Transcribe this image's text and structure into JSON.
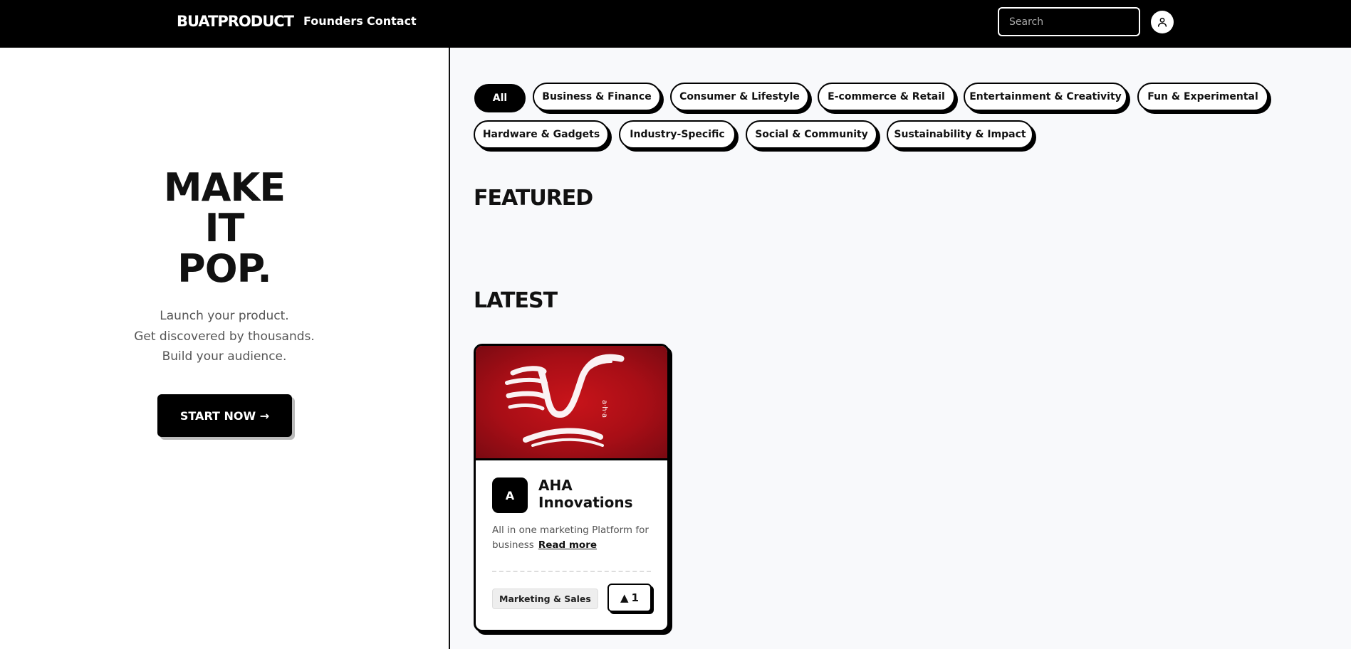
{
  "header": {
    "brand": "BUATPRODUCT",
    "nav": [
      "Founders",
      "Contact"
    ],
    "search_placeholder": "Search",
    "user_icon": "user-icon"
  },
  "hero": {
    "title_lines": [
      "MAKE",
      "IT",
      "POP."
    ],
    "subtitle_lines": [
      "Launch your product.",
      "Get discovered by thousands.",
      "Build your audience."
    ],
    "cta": "START NOW →"
  },
  "categories": [
    {
      "label": "All",
      "active": true
    },
    {
      "label": "Business & Finance",
      "active": false
    },
    {
      "label": "Consumer & Lifestyle",
      "active": false
    },
    {
      "label": "E-commerce & Retail",
      "active": false
    },
    {
      "label": "Entertainment & Creativity",
      "active": false
    },
    {
      "label": "Fun & Experimental",
      "active": false
    },
    {
      "label": "Hardware & Gadgets",
      "active": false
    },
    {
      "label": "Industry-Specific",
      "active": false
    },
    {
      "label": "Social & Community",
      "active": false
    },
    {
      "label": "Sustainability & Impact",
      "active": false
    }
  ],
  "sections": {
    "featured": "FEATURED",
    "latest": "LATEST"
  },
  "latest_products": [
    {
      "logo_letter": "A",
      "image_brand_text": "a·h·a",
      "name": "AHA Innovations",
      "description": "All in one marketing Platform for business",
      "read_more": "Read more",
      "tag": "Marketing & Sales",
      "vote_icon": "▲",
      "votes": "1"
    }
  ],
  "colors": {
    "topbar": "#000000",
    "accent": "#000000",
    "panel_bg": "#f8f9fb",
    "card_image": "#b5121b"
  }
}
